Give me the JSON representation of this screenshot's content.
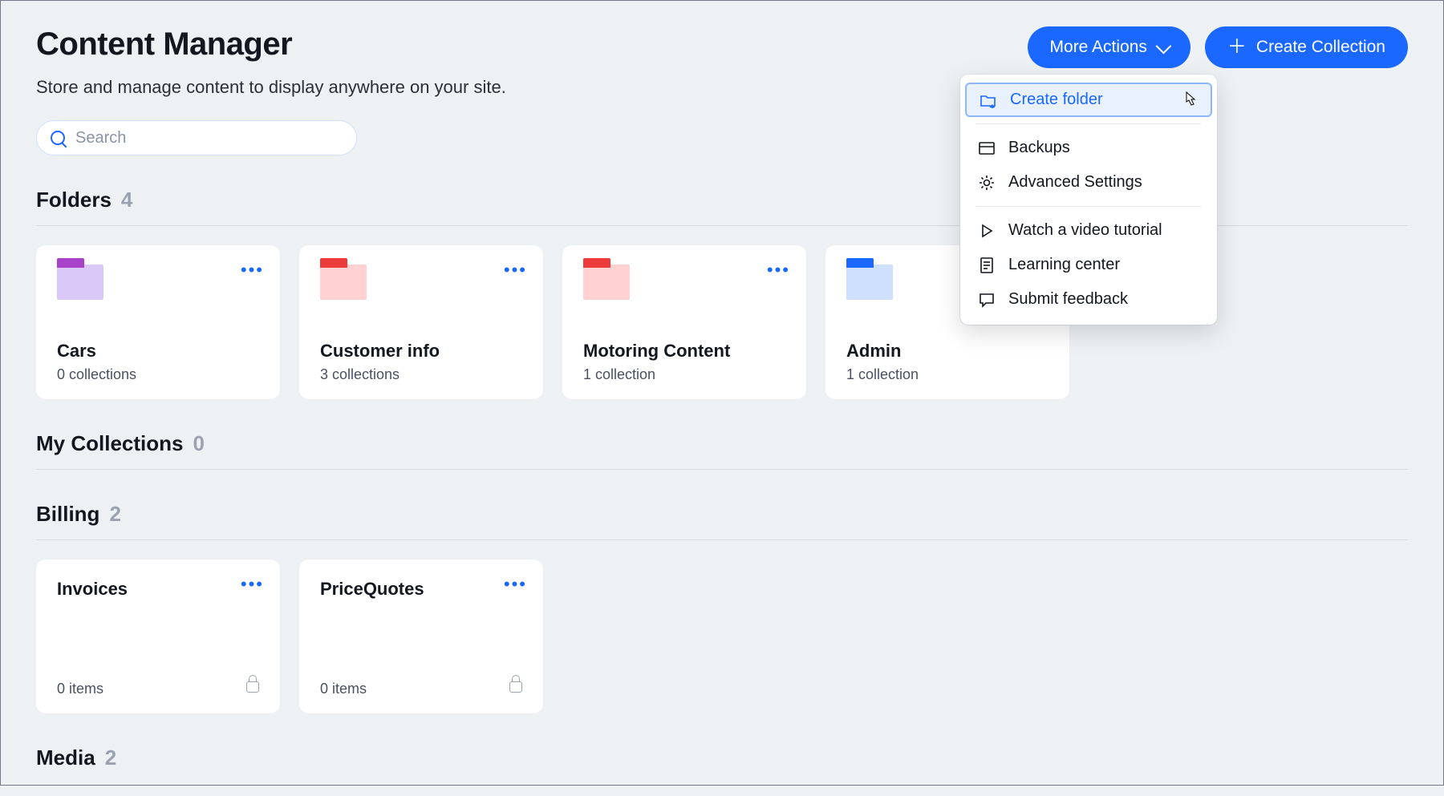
{
  "header": {
    "title": "Content Manager",
    "subtitle": "Store and manage content to display anywhere on your site."
  },
  "buttons": {
    "more_actions": "More Actions",
    "create_collection": "Create Collection"
  },
  "search": {
    "placeholder": "Search"
  },
  "dropdown": {
    "create_folder": "Create folder",
    "backups": "Backups",
    "advanced_settings": "Advanced Settings",
    "watch_tutorial": "Watch a video tutorial",
    "learning_center": "Learning center",
    "submit_feedback": "Submit feedback"
  },
  "sections": {
    "folders": {
      "label": "Folders",
      "count": "4"
    },
    "my_collections": {
      "label": "My Collections",
      "count": "0"
    },
    "billing": {
      "label": "Billing",
      "count": "2"
    },
    "media": {
      "label": "Media",
      "count": "2"
    }
  },
  "folders": [
    {
      "name": "Cars",
      "sub": "0 collections",
      "color": "violet"
    },
    {
      "name": "Customer info",
      "sub": "3 collections",
      "color": "pink"
    },
    {
      "name": "Motoring Content",
      "sub": "1 collection",
      "color": "red"
    },
    {
      "name": "Admin",
      "sub": "1 collection",
      "color": "blue"
    }
  ],
  "billing_collections": [
    {
      "name": "Invoices",
      "sub": "0 items"
    },
    {
      "name": "PriceQuotes",
      "sub": "0 items"
    }
  ]
}
